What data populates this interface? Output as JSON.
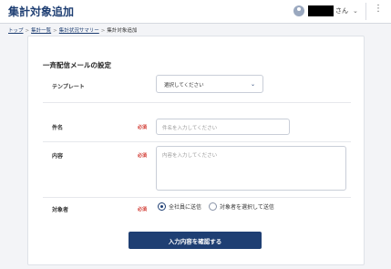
{
  "header": {
    "title": "集計対象追加",
    "user_suffix": "さん",
    "user_menu_icon": "chevron-down-icon",
    "more_icon": "kebab-menu-icon"
  },
  "breadcrumb": {
    "items": [
      "トップ",
      "集計一覧",
      "集計状況サマリー",
      "集計対象追加"
    ],
    "separator": ">"
  },
  "form": {
    "section_title": "一斉配信メールの設定",
    "required_label": "必須",
    "template": {
      "label": "テンプレート",
      "selected": "選択してください"
    },
    "subject": {
      "label": "件名",
      "placeholder": "件名を入力してください"
    },
    "body": {
      "label": "内容",
      "placeholder": "内容を入力してください"
    },
    "target": {
      "label": "対象者",
      "options": [
        "全社員に送信",
        "対象者を選択して送信"
      ],
      "selected_index": 0
    },
    "confirm_button": "入力内容を確認する"
  },
  "colors": {
    "brand": "#1f3f73",
    "required": "#d0342c",
    "background": "#f3f4f7"
  }
}
